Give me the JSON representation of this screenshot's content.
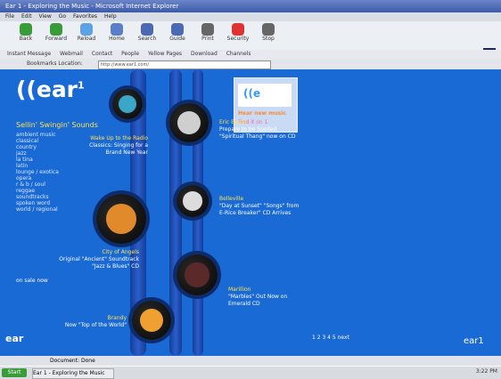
{
  "browser": {
    "title": "Ear 1 - Exploring the Music - Microsoft Internet Explorer",
    "menu": [
      "File",
      "Edit",
      "View",
      "Go",
      "Favorites",
      "Help"
    ],
    "toolbar": [
      {
        "label": "Back",
        "icon": "back-icon",
        "color": "#3a9b3a"
      },
      {
        "label": "Forward",
        "icon": "forward-icon",
        "color": "#3a9b3a"
      },
      {
        "label": "Reload",
        "icon": "reload-icon",
        "color": "#5da3e4"
      },
      {
        "label": "Home",
        "icon": "home-icon",
        "color": "#5a7fc7"
      },
      {
        "label": "Search",
        "icon": "search-icon",
        "color": "#4b6ab3"
      },
      {
        "label": "Guide",
        "icon": "guide-icon",
        "color": "#4b6ab3"
      },
      {
        "label": "Print",
        "icon": "print-icon",
        "color": "#666"
      },
      {
        "label": "Security",
        "icon": "security-icon",
        "color": "#d33"
      },
      {
        "label": "Stop",
        "icon": "stop-icon",
        "color": "#666"
      }
    ],
    "quick_links": [
      "Instant Message",
      "Webmail",
      "Contact",
      "People",
      "Yellow Pages",
      "Download",
      "Channels"
    ],
    "address_label": "Bookmarks  Location:",
    "address_value": "http://www.ear1.com/",
    "corner_logo": "N"
  },
  "page": {
    "logo": "ear",
    "logo_sup": "1",
    "side_header": "Sellin' Swingin' Sounds",
    "side_items": [
      "ambient music",
      "classical",
      "country",
      "jazz",
      "la tina",
      "latin",
      "lounge / exotica",
      "opera",
      "r & b / soul",
      "reggae",
      "soundtracks",
      "spoken word",
      "world / regional"
    ],
    "bottom_text": "on  sale  now",
    "promo": {
      "line1": "Hear new music",
      "line2": "Find it on 1"
    },
    "captions": [
      {
        "hd": "Wake Up to the Radio",
        "body": "Classics: Singing for a Brand New Year"
      },
      {
        "hd": "Eric Benét",
        "body": "Prepare to be Spoiled \"Spiritual Thang\" now on CD"
      },
      {
        "hd": "Belleville",
        "body": "\"Day at Sunset\" \"Songs\" from E-Rice Breaker\" CD Arrives"
      },
      {
        "hd": "City of Angels",
        "body": "Original \"Ancient\" Soundtrack \"Jazz & Blues\" CD"
      },
      {
        "hd": "Marillion",
        "body": "\"Marbles\" Out Now on Emerald CD"
      },
      {
        "hd": "Brandy",
        "body": "Now \"Top of the World\""
      }
    ],
    "pager": "1 2 3 4 5 next",
    "brand": "ear1",
    "ear_bottom": "ear"
  },
  "status": {
    "text": "Document: Done"
  },
  "taskbar": {
    "start": "Start",
    "task": "Ear 1 - Exploring the Music",
    "tray_time": "3:22 PM"
  }
}
